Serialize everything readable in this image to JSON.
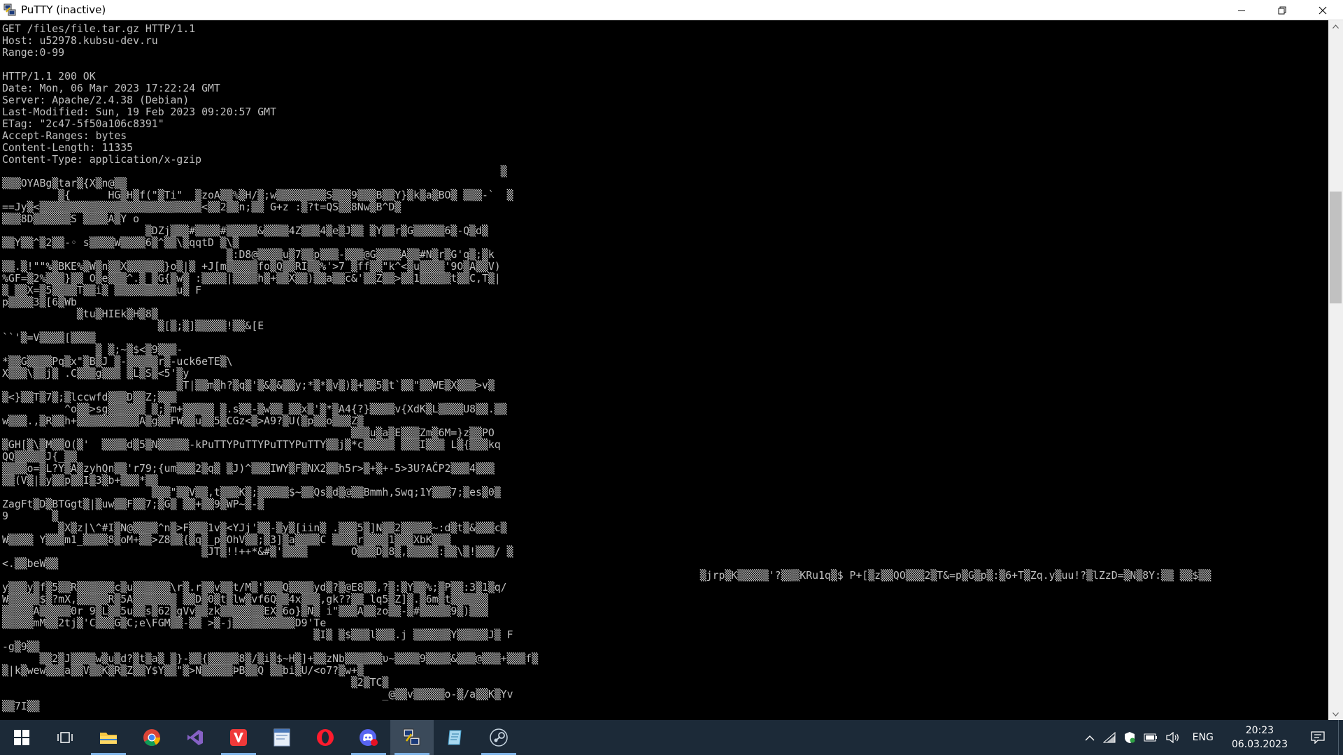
{
  "window": {
    "title": "PuTTY (inactive)",
    "controls": {
      "minimize": "—",
      "restore": "❐",
      "close": "✕"
    }
  },
  "terminal": {
    "lines": [
      "GET /files/file.tar.gz HTTP/1.1",
      "Host: u52978.kubsu-dev.ru",
      "Range:0-99",
      "",
      "HTTP/1.1 200 OK",
      "Date: Mon, 06 Mar 2023 17:22:24 GMT",
      "Server: Apache/2.4.38 (Debian)",
      "Last-Modified: Sun, 19 Feb 2023 09:20:57 GMT",
      "ETag: \"2c47-5f50a106c8391\"",
      "Accept-Ranges: bytes",
      "Content-Length: 11335",
      "Content-Type: application/x-gzip",
      "                                                                                ▒",
      "▒▒▒OYABg▒tar▒{X▒n@▒▒",
      "         ▒{      HG▒H▒f(\"▒Ti\"  ▒zoA▒▒%▒H/▒;w▒▒▒▒▒▒▒▒S▒▒▒9▒▒▒B▒▒Y}▒k▒a▒BO▒ ▒▒▒-`  ▒",
      "==Jy▒<▒▒▒▒▒▒▒▒▒▒▒▒▒▒▒▒▒▒▒▒▒▒▒▒▒▒<▒▒2▒▒n;▒▒ G+z :▒?t=QS▒▒8Nw▒B^D▒",
      "▒▒▒8D▒▒▒▒▒▒S ▒▒▒▒A▒Y o",
      "                       ▒DZj▒▒▒#▒▒▒▒#▒▒▒▒▒&▒▒▒▒4Z▒▒▒4▒e▒J▒▒ ▒Y▒▒r▒G▒▒▒▒▒6▒-Q▒d▒",
      "▒▒Y▒▒^▒2▒▒-◦ s▒▒▒▒W▒▒▒▒6▒^▒▒\\▒qqtD ▒\\▒",
      "                                    ▒:D8@▒▒▒▒u▒7▒▒p▒▒▒-▒▒▒@G▒▒▒▒A▒▒#N▒r▒G'q▒;▒k",
      "▒▒.▒!\"\"%▒BKE%▒W▒n▒▒X▒▒▒▒▒▒}o▒|▒ +J[m▒▒▒▒▒fo▒Q▒▒RI▒▒%'>7_▒ff▒▒\"k^<▒u▒▒▒▒'9O▒A▒▒V)",
      "%GF=▒2%▒▒▒}▒▒ O▒e▒▒▒^.▒_▒G{▒w▒ :▒▒▒▒|▒▒▒▒h▒+▒▒X▒▒)▒▒a▒▒c&'▒▒Z▒▒>▒▒1▒▒▒▒▒t▒▒C,T▒|",
      "▒ ▒▒X=▒5▒▒▒▒T▒▒i▒ ▒▒▒▒▒▒▒▒▒▒u▒ F",
      "p▒▒▒▒3▒[6▒Wb",
      "            ▒tu▒HIEk▒H▒8▒",
      "                         ▒[▒;▒]▒▒▒▒▒!▒▒&[E",
      "``'▒=V▒▒▒▒[▒▒▒▒",
      "               ▒ ▒;~▒$<▒9▒▒▒-",
      "*▒▒G▒▒▒▒Pq▒x\"▒B▒J ▒-▒▒▒▒▒r▒-uck6eTE▒\\",
      "X▒▒▒\\▒▒j▒ .C▒▒▒g▒▒▒ ▒L▒S▒<5'▒y",
      "                            ▒T|▒▒m▒h?▒q▒'▒&▒&▒▒y;*▒*▒v▒)▒+▒▒5▒t`▒▒\"▒▒WE▒X▒▒▒>v▒",
      "▒<}▒▒T▒7▒;▒lccwfd▒▒▒D▒▒Z;▒▒▒",
      "          ^o▒▒>sg▒▒▒▒▒▒ ▒;▒m+▒▒▒▒▒ ▒.s▒▒-▒w▒▒_▒▒x▒'▒*▒A4{?}▒▒▒▒v{XdK▒L▒▒▒▒U8▒▒.▒▒",
      "w▒▒▒.,▒R▒▒h+▒▒▒▒▒▒▒▒▒▒A▒g▒▒FW▒▒u▒▒5▒CGz<▒>A9?▒U(▒p▒▒o▒▒▒Z▒",
      "                                                        ▒▒▒u▒a▒E▒▒▒Zm▒6M=}z▒▒PO",
      "▒GH[▒\\▒M▒▒O(▒'  ▒▒▒▒d▒5▒N▒▒▒▒▒-kPuTTYPuTTYPuTTYPuTTY▒▒j▒*c▒▒▒▒▒ ▒▒▒I▒▒▒ L▒{▒▒▒kq",
      "QQ▒▒▒▒▒J{_▒▒",
      "▒▒▒▒o=▒L?Y▒A▒zyhQn▒▒'r79;{um▒▒▒2▒q▒ ▒J)^▒▒▒IWY▒F▒NX2▒▒h5r>▒+▒+-5>3U?AČP2▒▒▒4▒▒▒",
      "▒▒(V▒|▒y▒▒p▒▒I▒3▒b+▒▒▒*▒▒",
      "                        ▒▒▒\"▒▒V▒▒,t▒▒▒K▒;▒▒▒▒▒$~▒▒Qs▒d▒@▒▒Bmmh,Swq;1Y▒▒▒7;▒es▒0▒",
      "ZagFt▒D▒BTGgt▒|▒uw▒▒F▒▒7;▒G▒ ▒▒+▒▒9▒WP~▒-▒",
      "9       ▒",
      "         ▒X▒z|\\^#I▒N@▒▒▒▒^n▒>F▒▒▒1v▒<YJj'▒▒-▒y▒[iin▒ .▒▒▒5▒]N▒▒2▒▒▒▒▒~:d▒t▒&▒▒▒c▒",
      "W▒▒▒▒ Y▒▒▒m1_▒▒▒▒8▒oM+▒▒>Z8▒▒{▒q▒_p▒OhV▒▒;▒3]▒a▒▒▒▒C ▒▒▒▒r▒▒▒▒1▒▒▒XbK▒▒▒",
      "                                ▒JT▒!!++*&#▒'▒▒▒▒       O▒▒▒D▒8▒,▒▒▒▒▒:▒▒\\▒!▒▒▒/ ▒",
      "<.▒▒beW▒▒",
      "                                                                                                                ▒jrp▒K▒▒▒▒▒'?▒▒▒KRu1q▒$ P+[▒z▒▒QO▒▒▒2▒T&=p▒G▒p▒:▒6+T▒Zq.y▒uu!?▒lZzD=▒N▒8Y:▒▒ ▒▒$▒▒",
      "y▒▒▒y▒f▒5▒▒R▒▒▒▒▒▒c▒u▒▒▒▒▒▒\\r▒.r▒▒v▒▒t/M▒'▒▒▒Q▒▒▒▒yd▒?▒@E8▒▒,?▒:▒Y▒▒%;▒P▒▒:3▒1▒q/",
      "W▒▒▒▒▒$▒?mX,▒▒▒▒▒R▒5A▒▒▒▒▒▒▒ ▒▒D▒0▒t▒lw▒vf6Q▒▒4x▒▒▒,gk??▒▒ lq5▒Z]▒.▒6m▒t▒▒▒▒▒▒",
      "▒▒▒▒▒A▒▒▒▒▒0r 9▒L▒▒5u▒▒s▒62▒gVv▒▒zk▒▒▒▒▒▒▒EX▒6o}▒N▒ i\"▒▒▒A▒▒zo▒▒-▒#▒▒▒▒▒9▒)▒▒▒",
      "▒▒▒▒▒mM▒▒2tj▒'C▒▒▒G▒C;e\\FGM▒▒-▒▒ >▒-j▒▒▒▒▒▒▒▒▒▒D9'Te",
      "                                                  ▒I▒ ▒$▒▒▒l▒▒▒.j ▒▒▒▒▒▒Y▒▒▒▒▒J▒ F",
      "-g▒9▒▒",
      "      ▒▒2▒J▒▒▒▒w▒u▒d?▒t▒a▒ ▒}-▒▒{▒▒▒▒▒8▒/▒i▒$~H▒]+▒▒zNb▒▒▒▒▒▒υ~▒▒▒▒9▒▒▒▒&▒▒▒@▒▒▒+▒▒▒f▒",
      "▒|k▒wew▒▒▒a▒▒V▒▒K▒R▒Z▒▒Y$Y▒▒\"▒>N▒▒▒▒▒ÞB▒▒Q ▒▒bi▒U/<o7?▒w+▒",
      "                                                        ▒2▒TC▒",
      "                                                             _@▒▒v▒▒▒▒▒o-▒/a▒▒K▒Yv",
      "▒▒7I▒▒"
    ]
  },
  "taskbar": {
    "apps": [
      {
        "name": "windows-start",
        "label": "Start"
      },
      {
        "name": "task-view",
        "label": "Task View"
      },
      {
        "name": "file-explorer",
        "label": "File Explorer"
      },
      {
        "name": "chrome",
        "label": "Google Chrome"
      },
      {
        "name": "visual-studio",
        "label": "Visual Studio"
      },
      {
        "name": "vivaldi",
        "label": "Vivaldi"
      },
      {
        "name": "notepad-app",
        "label": "App"
      },
      {
        "name": "opera",
        "label": "Opera"
      },
      {
        "name": "discord",
        "label": "Discord"
      },
      {
        "name": "putty",
        "label": "PuTTY"
      },
      {
        "name": "inkpad",
        "label": "App"
      },
      {
        "name": "steam",
        "label": "Steam"
      }
    ],
    "tray": {
      "language": "ENG",
      "time": "20:23",
      "date": "06.03.2023"
    }
  },
  "colors": {
    "terminal_bg": "#000000",
    "terminal_fg": "#c0c0c0",
    "taskbar_bg": "#1c2a38",
    "accent": "#7fb3e6"
  }
}
